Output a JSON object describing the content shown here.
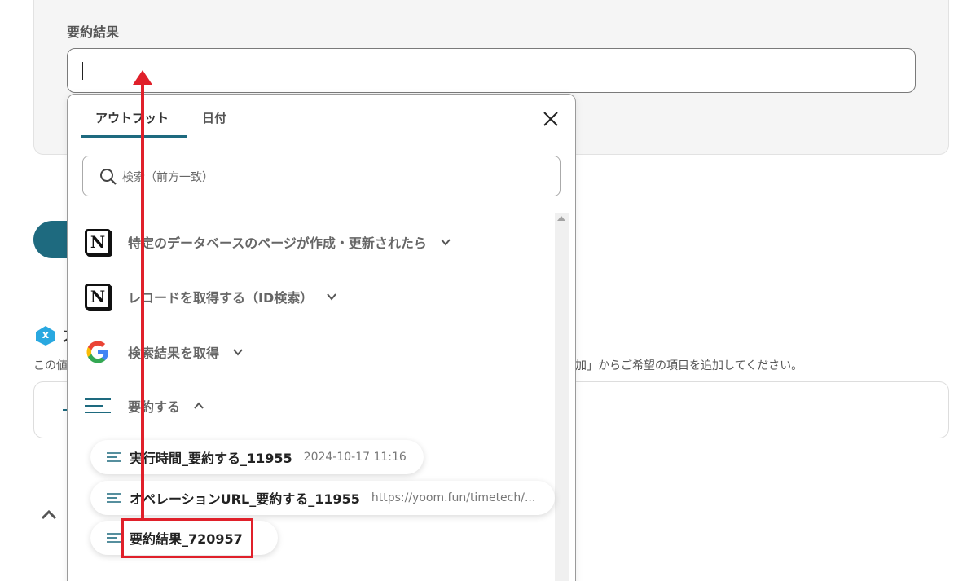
{
  "field": {
    "label": "要約結果",
    "value": ""
  },
  "background": {
    "sub_title_fragment": "ス",
    "help_left": "この値",
    "help_right": "追加」からご希望の項目を追加してください。"
  },
  "popup": {
    "tabs": [
      {
        "label": "アウトプット",
        "active": true
      },
      {
        "label": "日付",
        "active": false
      }
    ],
    "search_placeholder": "検索（前方一致）",
    "sources": [
      {
        "icon": "notion-icon",
        "label": "特定のデータベースのページが作成・更新されたら",
        "expanded": false
      },
      {
        "icon": "notion-icon",
        "label": "レコードを取得する（ID検索）",
        "expanded": false
      },
      {
        "icon": "google-icon",
        "label": "検索結果を取得",
        "expanded": false
      },
      {
        "icon": "summary-lines-icon",
        "label": "要約する",
        "expanded": true
      }
    ],
    "outputs": [
      {
        "label": "実行時間_要約する_11955",
        "meta": "2024-10-17 11:16"
      },
      {
        "label": "オペレーションURL_要約する_11955",
        "meta": "https://yoom.fun/timetech/..."
      },
      {
        "label": "要約結果_720957",
        "meta": ""
      }
    ]
  },
  "colors": {
    "accent": "#1e6a7f",
    "annotation": "#e0202a",
    "google_blue": "#4285F4",
    "google_red": "#EA4335",
    "google_yellow": "#FBBC05",
    "google_green": "#34A853"
  }
}
